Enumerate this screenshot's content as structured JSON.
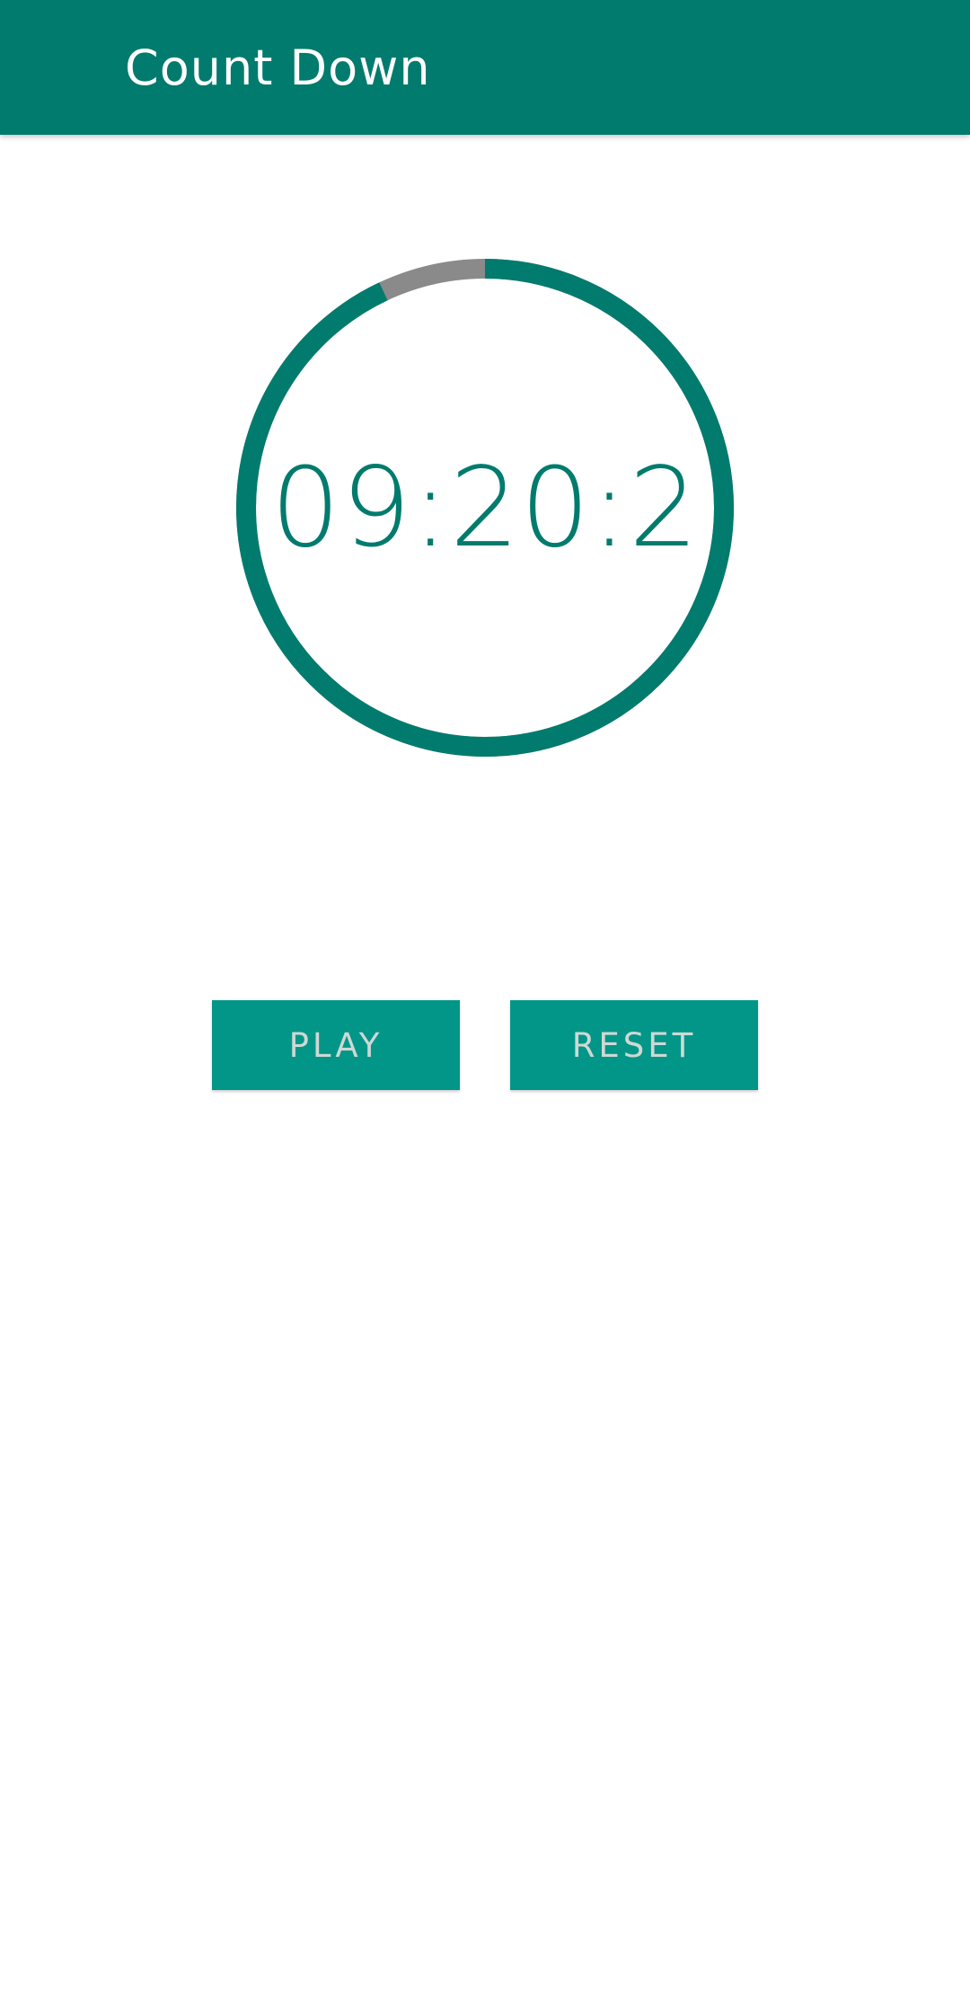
{
  "app_bar": {
    "title": "Count Down",
    "color": "#017b6d"
  },
  "timer": {
    "display": "09:20:2",
    "ring_color": "#017b6d",
    "track_color": "#8a8a8a",
    "remaining_fraction": 0.93
  },
  "controls": {
    "play_label": "PLAY",
    "reset_label": "RESET",
    "button_color": "#029688"
  }
}
